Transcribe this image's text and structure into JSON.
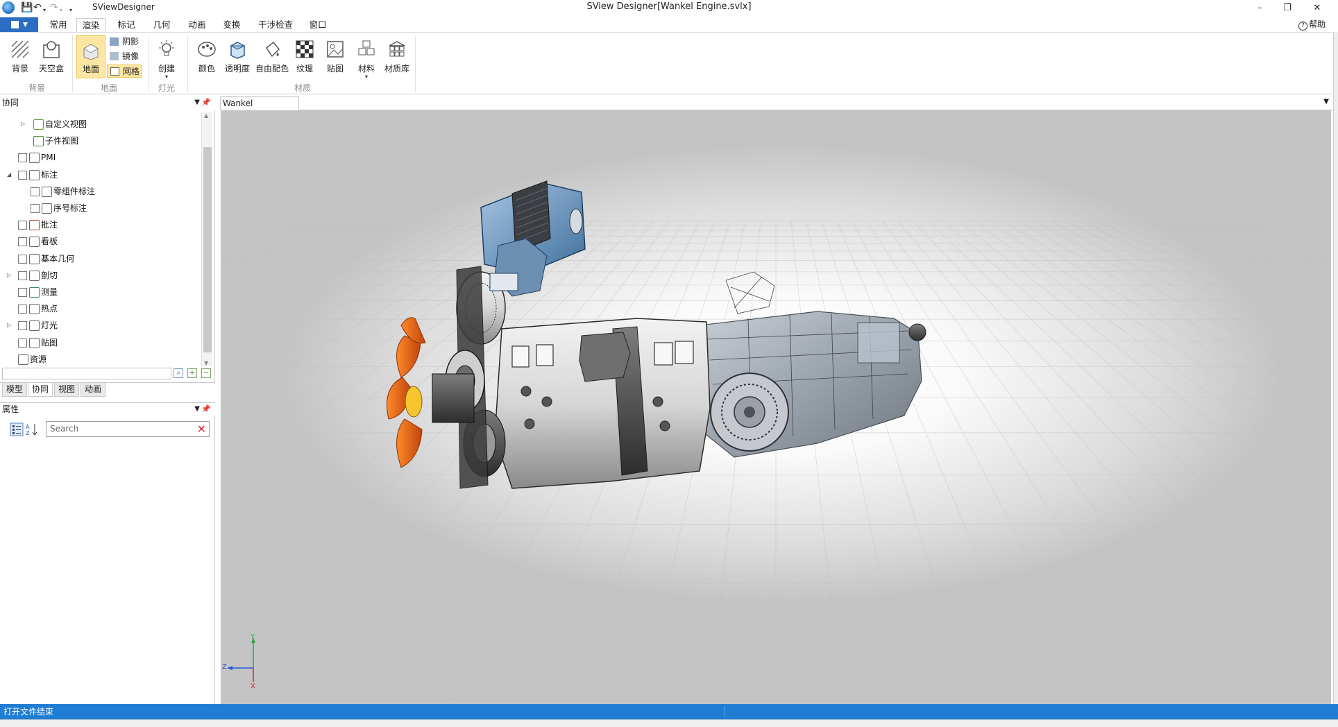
{
  "window": {
    "app_name": "SViewDesigner",
    "title": "SView Designer[Wankel Engine.svlx]",
    "minimize": "–",
    "restore": "❐",
    "close": "✕"
  },
  "menu": {
    "tabs": [
      "常用",
      "渲染",
      "标记",
      "几何",
      "动画",
      "变换",
      "干涉检查",
      "窗口"
    ],
    "active_tab": "渲染",
    "help": "帮助"
  },
  "ribbon": {
    "background_group": {
      "label": "背景",
      "buttons": [
        "背景",
        "天空盒"
      ]
    },
    "ground_group": {
      "label": "地面",
      "ground_button": "地面",
      "small_buttons": [
        "阴影",
        "镜像",
        "网格"
      ]
    },
    "light_group": {
      "label": "灯光",
      "create_button": "创建"
    },
    "material_group": {
      "label": "材质",
      "buttons": [
        "颜色",
        "透明度",
        "自由配色",
        "纹理",
        "贴图",
        "材料",
        "材质库"
      ]
    }
  },
  "collab_panel": {
    "title": "协同",
    "tree": [
      {
        "label": "自定义视图",
        "indent": 1,
        "expand": "▷",
        "checkbox": false
      },
      {
        "label": "子件视图",
        "indent": 1,
        "expand": "",
        "checkbox": false
      },
      {
        "label": "PMI",
        "indent": 0,
        "expand": "",
        "checkbox": true
      },
      {
        "label": "标注",
        "indent": 0,
        "expand": "◢",
        "checkbox": true
      },
      {
        "label": "零组件标注",
        "indent": 1,
        "expand": "",
        "checkbox": true
      },
      {
        "label": "序号标注",
        "indent": 1,
        "expand": "",
        "checkbox": true
      },
      {
        "label": "批注",
        "indent": 0,
        "expand": "",
        "checkbox": true
      },
      {
        "label": "看板",
        "indent": 0,
        "expand": "",
        "checkbox": true
      },
      {
        "label": "基本几何",
        "indent": 0,
        "expand": "",
        "checkbox": true
      },
      {
        "label": "剖切",
        "indent": 0,
        "expand": "▷",
        "checkbox": true
      },
      {
        "label": "测量",
        "indent": 0,
        "expand": "",
        "checkbox": true
      },
      {
        "label": "热点",
        "indent": 0,
        "expand": "",
        "checkbox": true
      },
      {
        "label": "灯光",
        "indent": 0,
        "expand": "▷",
        "checkbox": true
      },
      {
        "label": "贴图",
        "indent": 0,
        "expand": "",
        "checkbox": true
      },
      {
        "label": "资源",
        "indent": 0,
        "expand": "",
        "checkbox": false
      }
    ],
    "bottom_tabs": [
      "模型",
      "协同",
      "视图",
      "动画"
    ],
    "active_bottom_tab": "协同"
  },
  "property_panel": {
    "title": "属性",
    "search_placeholder": "Search"
  },
  "document": {
    "tab_label": "Wankel Engine.svlx",
    "triad": {
      "y": "Y",
      "z": "Z",
      "x": "X"
    }
  },
  "status": {
    "message": "打开文件结束"
  },
  "colors": {
    "accent": "#1f7dd3",
    "file_button": "#2b6dc2",
    "selected_ribbon": "#fde6a3"
  }
}
